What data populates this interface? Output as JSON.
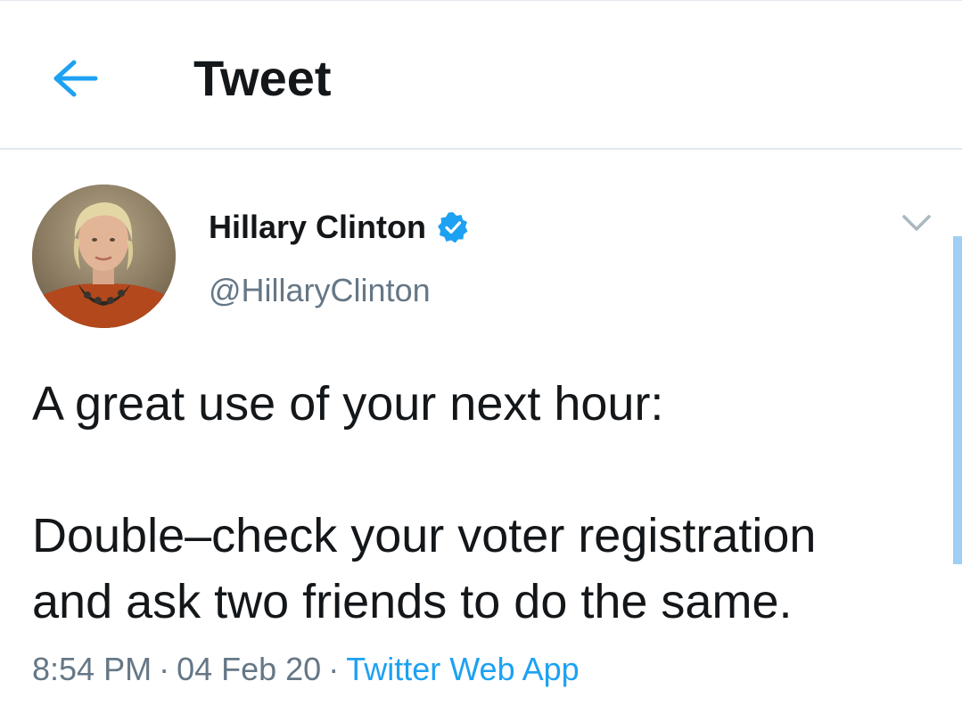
{
  "header": {
    "back_icon": "arrow-left-icon",
    "title": "Tweet"
  },
  "tweet": {
    "author": {
      "name": "Hillary Clinton",
      "handle": "@HillaryClinton",
      "verified_icon": "verified-badge-icon"
    },
    "menu_icon": "chevron-down-icon",
    "text_lines": [
      "A great use of your next hour:",
      "Double–check your voter registration",
      "and ask two friends to do the same."
    ],
    "time": "8:54 PM",
    "separator": "·",
    "date": "04 Feb 20",
    "source": "Twitter Web App"
  },
  "colors": {
    "accent": "#1da1f2",
    "text": "#14171a",
    "muted": "#657786",
    "divider": "#e1e8ed"
  }
}
